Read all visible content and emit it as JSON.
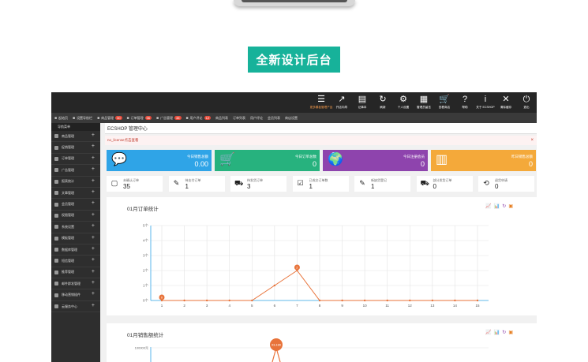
{
  "banner": {
    "text": "全新设计后台"
  },
  "topbar": {
    "items": [
      {
        "glyph": "☰",
        "label": "更多模板管理产品"
      },
      {
        "glyph": "↗",
        "label": "开店向导"
      },
      {
        "glyph": "▤",
        "label": "记事本"
      },
      {
        "glyph": "↻",
        "label": "刷新"
      },
      {
        "glyph": "⚙",
        "label": "个人设置"
      },
      {
        "glyph": "▦",
        "label": "管理员留言"
      },
      {
        "glyph": "🛒",
        "label": "查看商店"
      },
      {
        "glyph": "?",
        "label": "帮助"
      },
      {
        "glyph": "i",
        "label": "关于 ECSHOP"
      },
      {
        "glyph": "✕",
        "label": "清除缓存"
      },
      {
        "glyph": "⏻",
        "label": "退出"
      }
    ]
  },
  "menubar": {
    "items": [
      {
        "label": "起始页",
        "badge": ""
      },
      {
        "label": "设置导航栏",
        "badge": ""
      },
      {
        "label": "商品管理",
        "badge": "30"
      },
      {
        "label": "订单管理",
        "badge": "06"
      },
      {
        "label": "广告管理",
        "badge": "45"
      },
      {
        "label": "用户评论",
        "badge": "12"
      },
      {
        "label": "商品列表",
        "badge": ""
      },
      {
        "label": "订单列表",
        "badge": ""
      },
      {
        "label": "用户评论",
        "badge": ""
      },
      {
        "label": "会员列表",
        "badge": ""
      },
      {
        "label": "商店设置",
        "badge": ""
      }
    ]
  },
  "sidebar": {
    "title": "导航菜单",
    "items": [
      "商品管理",
      "促销管理",
      "订单管理",
      "广告管理",
      "报表统计",
      "文章管理",
      "会员管理",
      "权限管理",
      "系统设置",
      "模板管理",
      "数据库管理",
      "短信管理",
      "推荐管理",
      "邮件群发管理",
      "移动营销插件",
      "云服务中心"
    ]
  },
  "breadcrumb": {
    "text": "ECSHOP 管理中心"
  },
  "notice": {
    "text": "no_license点击查看",
    "close": "×"
  },
  "stats": [
    {
      "label": "今日销售总额",
      "value": "0.00",
      "color": "#2fa4e7",
      "icon": "💬"
    },
    {
      "label": "今日订单总数",
      "value": "0",
      "color": "#27b27e",
      "icon": "🛒"
    },
    {
      "label": "今日注册会员",
      "value": "0",
      "color": "#8e44ad",
      "icon": "🌍"
    },
    {
      "label": "昨日销售总额",
      "value": "0",
      "color": "#f4a93a",
      "icon": "▥"
    }
  ],
  "orders": [
    {
      "label": "未确认订单",
      "value": "35",
      "icon": "▢"
    },
    {
      "label": "待支付订单",
      "value": "1",
      "icon": "✎"
    },
    {
      "label": "待发货订单",
      "value": "3",
      "icon": "⛟"
    },
    {
      "label": "已成交订单数",
      "value": "1",
      "icon": "☑"
    },
    {
      "label": "新缺货登记",
      "value": "1",
      "icon": "✎"
    },
    {
      "label": "部分发货订单",
      "value": "0",
      "icon": "⛟"
    },
    {
      "label": "退货申请",
      "value": "0",
      "icon": "⟲"
    }
  ],
  "charts": {
    "order_title": "01月订单统计",
    "sales_title": "01月销售额统计",
    "tools": [
      "📈",
      "📊",
      "↻",
      "▣"
    ],
    "tool_colors": [
      "#27ae60",
      "#2980b9",
      "#8e44ad",
      "#e67e22"
    ]
  },
  "chart_data": [
    {
      "type": "line",
      "title": "01月订单统计",
      "x": [
        1,
        2,
        3,
        4,
        5,
        6,
        7,
        8,
        9,
        10,
        11,
        12,
        13,
        14,
        15
      ],
      "series": [
        {
          "values": [
            0,
            0,
            0,
            0,
            0,
            1,
            2,
            0,
            0,
            0,
            0,
            0,
            0,
            0,
            0
          ]
        }
      ],
      "yticks": [
        "0个",
        "1个",
        "2个",
        "3个",
        "4个",
        "5个"
      ],
      "ylim": [
        0,
        5
      ],
      "highlight": [
        {
          "x": 1,
          "label": "0"
        },
        {
          "x": 7,
          "label": "2"
        }
      ],
      "line_color": "#e8733a"
    },
    {
      "type": "line",
      "title": "01月销售额统计",
      "ytick_top": "100000元",
      "peak_label": "93,186",
      "line_color": "#e8733a"
    }
  ]
}
